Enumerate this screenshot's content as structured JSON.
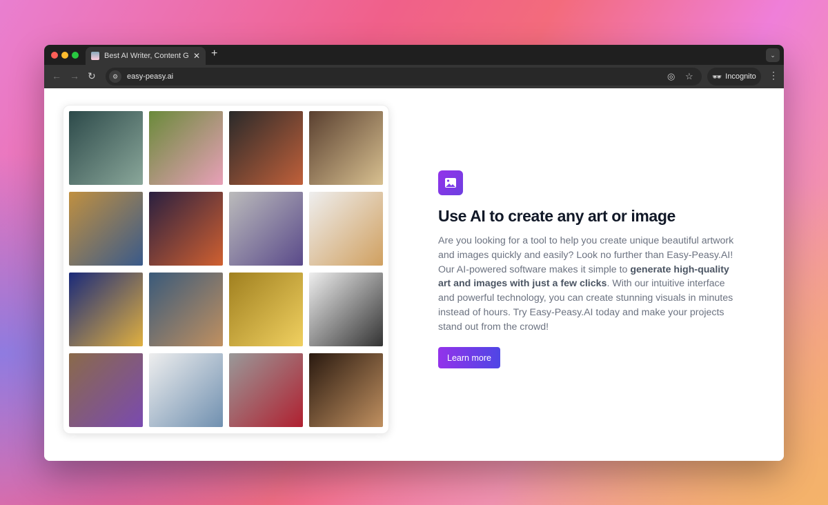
{
  "browser": {
    "tab_title": "Best AI Writer, Content Generator",
    "url": "easy-peasy.ai",
    "incognito_label": "Incognito"
  },
  "gallery": {
    "images": [
      "dragon",
      "woman-in-garden",
      "salmon-dish",
      "puppies-with-guitar",
      "giraffe-city",
      "basketball-space",
      "monster-truck",
      "birthday-cake",
      "new-year-party",
      "robot-comic",
      "banana-bed",
      "dining-room",
      "purple-monkey-cafe",
      "city-watercolor",
      "red-sports-car",
      "bread-closeup"
    ]
  },
  "feature": {
    "heading": "Use AI to create any art or image",
    "para_1": "Are you looking for a tool to help you create unique beautiful artwork and images quickly and easily? Look no further than Easy-Peasy.AI! Our AI-powered software makes it simple to ",
    "para_bold": "generate high-quality art and images with just a few clicks",
    "para_2": ". With our intuitive interface and powerful technology, you can create stunning visuals in minutes instead of hours. Try Easy-Peasy.AI today and make your projects stand out from the crowd!",
    "cta": "Learn more"
  },
  "colors": {
    "accent_start": "#9333ea",
    "accent_end": "#4f46e5"
  }
}
